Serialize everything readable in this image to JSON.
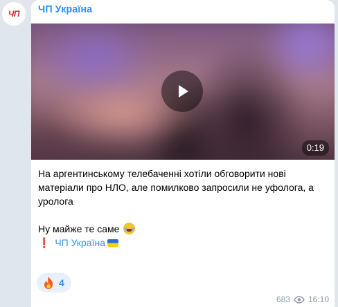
{
  "channel": {
    "avatar_text": "ЧП",
    "name": "ЧП Україна"
  },
  "video": {
    "duration": "0:19"
  },
  "post": {
    "line1": "На аргентинському телебаченні хотіли обговорити нові матеріали про НЛО, але помилково запросили не уфолога, а уролога",
    "line2": "Ну майже те саме",
    "signature_mark": "❗",
    "signature_link": "ЧП Україна"
  },
  "reaction": {
    "emoji": "fire-icon",
    "count": "4"
  },
  "meta": {
    "views": "683",
    "time": "16:10"
  },
  "colors": {
    "accent": "#3390ec",
    "brand_red": "#e0202a",
    "background": "#dfe6ec"
  }
}
